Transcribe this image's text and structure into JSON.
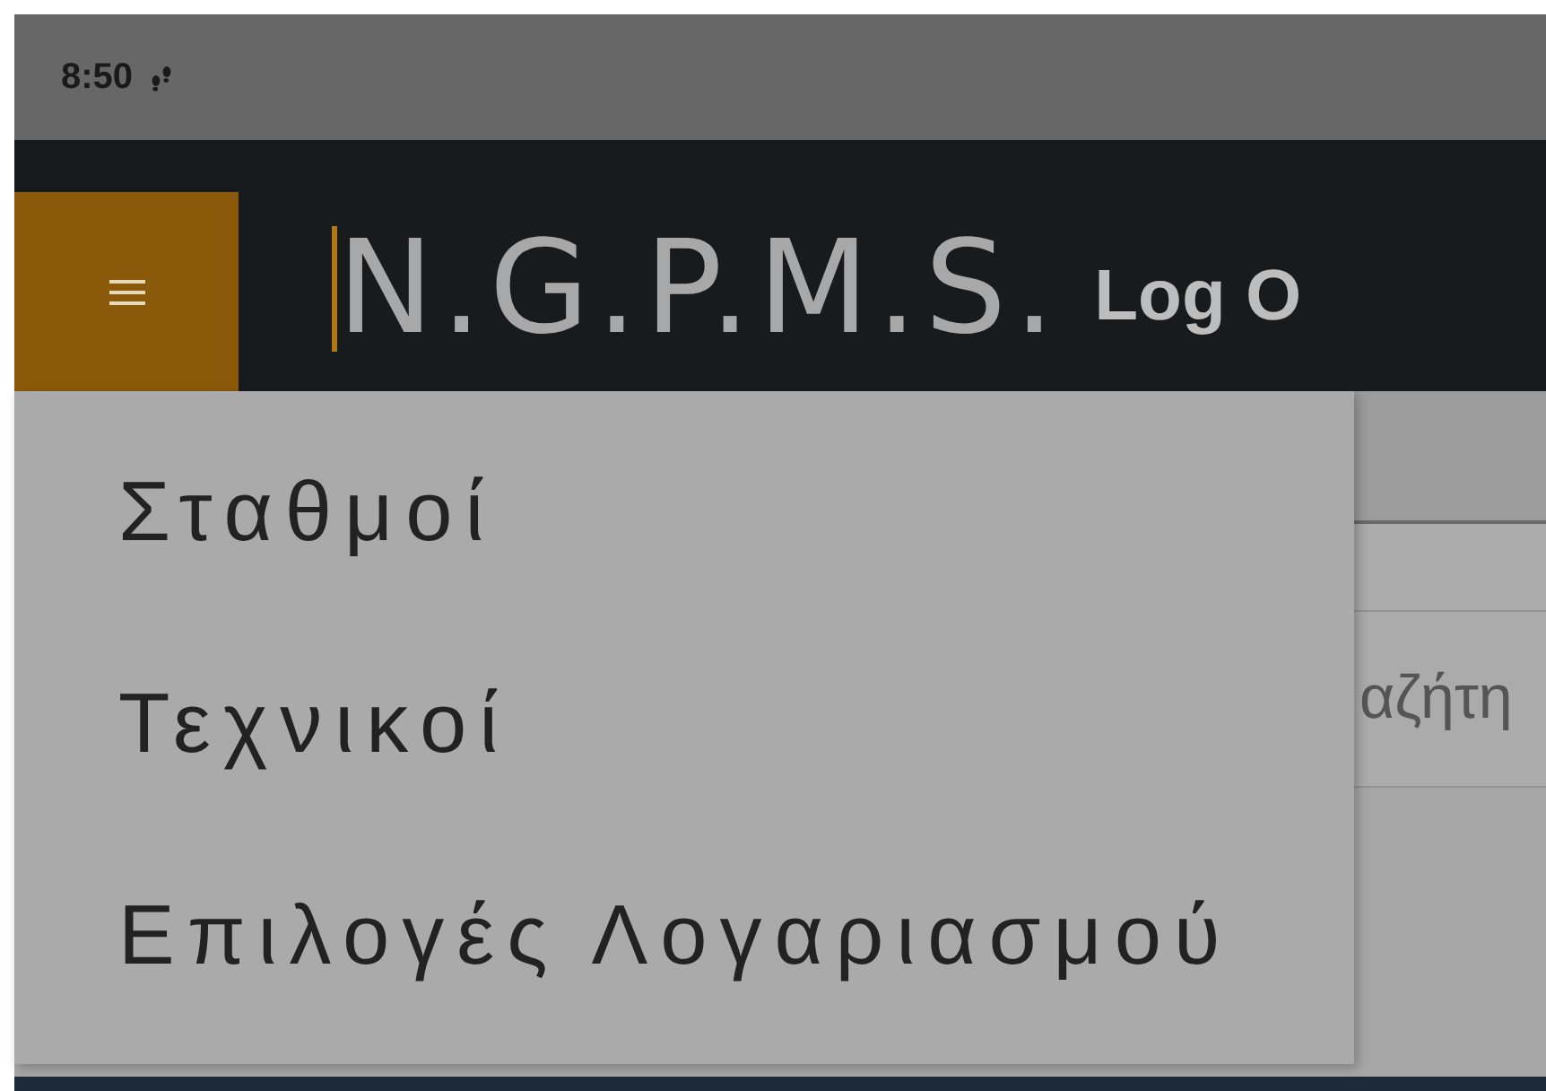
{
  "status_bar": {
    "time": "8:50"
  },
  "header": {
    "title": "N.G.P.M.S.",
    "action": "Log O"
  },
  "menu": {
    "items": [
      {
        "label": "Σταθμοί"
      },
      {
        "label": "Τεχνικοί"
      },
      {
        "label": "Επιλογές Λογαριασμού"
      }
    ]
  },
  "background": {
    "search_text": "αζήτη"
  }
}
